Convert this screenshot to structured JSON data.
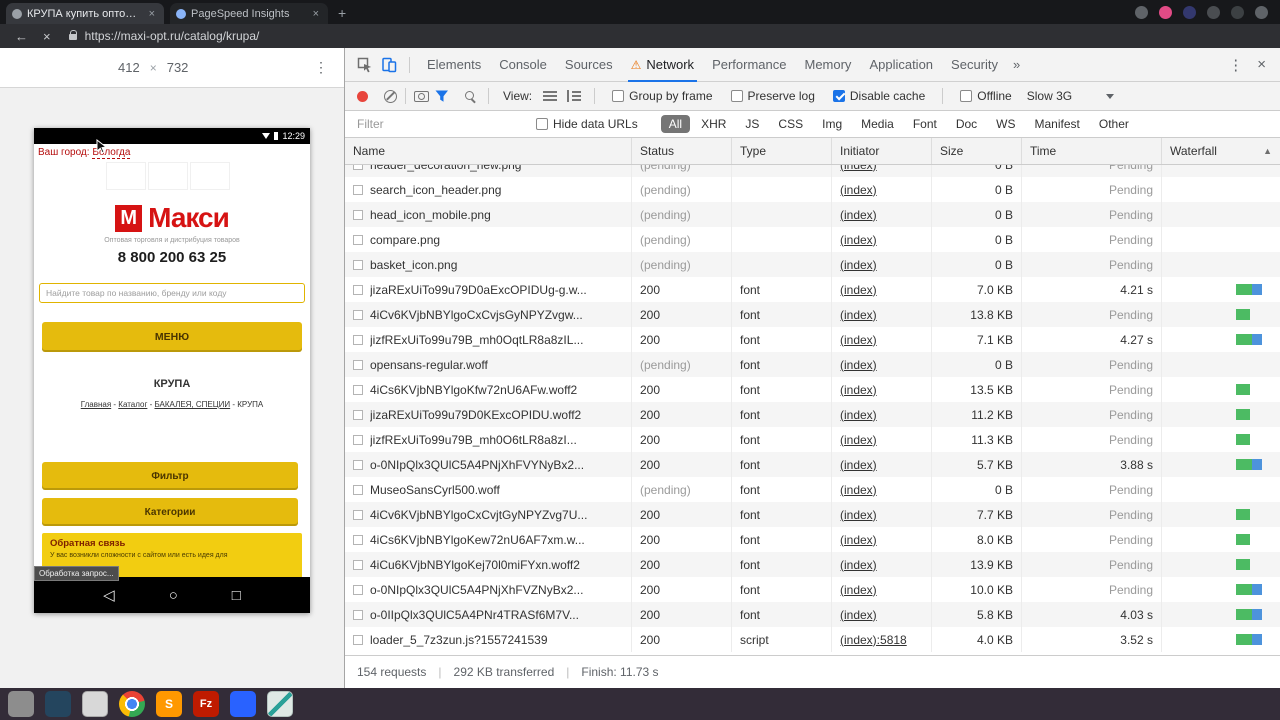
{
  "browser": {
    "tab1": "КРУПА купить оптом | О...",
    "tab2": "PageSpeed Insights",
    "new_tab": "+",
    "url": "https://maxi-opt.ru/catalog/krupa/",
    "icons": {
      "back": "←",
      "stop": "×",
      "close": "×"
    }
  },
  "emulator": {
    "width": "412",
    "height": "732",
    "sep": "×",
    "more": "⋮"
  },
  "mobile": {
    "status_time": "12:29",
    "city_label": "Ваш город:",
    "city_value": "Вологда",
    "logo_m": "М",
    "logo_text": "Макси",
    "tagline": "Оптовая торговля и дистрибуция товаров",
    "phone": "8 800 200 63 25",
    "search_placeholder": "Найдите товар по названию, бренду или коду",
    "menu_button": "МЕНЮ",
    "page_title": "КРУПА",
    "breadcrumbs": [
      "Главная",
      "Каталог",
      "БАКАЛЕЯ, СПЕЦИИ",
      "КРУПА"
    ],
    "breadcrumb_sep": " - ",
    "filter_button": "Фильтр",
    "categories_button": "Категории",
    "feedback_title": "Обратная связь",
    "feedback_text": "У вас возникли сложности с сайтом или есть идея для",
    "tooltip": "Обработка запрос...",
    "nav": {
      "back": "◁",
      "home": "○",
      "recents": "□"
    }
  },
  "devtools": {
    "tabs": [
      "Elements",
      "Console",
      "Sources",
      "Network",
      "Performance",
      "Memory",
      "Application",
      "Security"
    ],
    "active_tab": "Network",
    "tabs_overflow": "»",
    "icons": {
      "more": "⋮",
      "close": "×",
      "sort": "▲",
      "warning": "⚠"
    },
    "toolbar": {
      "view_label": "View:",
      "group_by_frame": "Group by frame",
      "preserve_log": "Preserve log",
      "disable_cache": "Disable cache",
      "offline": "Offline",
      "throttling": "Slow 3G"
    },
    "filter": {
      "placeholder": "Filter",
      "hide_data_urls": "Hide data URLs",
      "pills": [
        "All",
        "XHR",
        "JS",
        "CSS",
        "Img",
        "Media",
        "Font",
        "Doc",
        "WS",
        "Manifest",
        "Other"
      ],
      "active_pill": "All"
    },
    "table": {
      "columns": [
        "Name",
        "Status",
        "Type",
        "Initiator",
        "Size",
        "Time",
        "Waterfall"
      ]
    },
    "rows": [
      {
        "name": "header_decoration_new.png",
        "status": "(pending)",
        "type": "",
        "initiator": "(index)",
        "size": "0 B",
        "time": "Pending",
        "waterfall": "none"
      },
      {
        "name": "search_icon_header.png",
        "status": "(pending)",
        "type": "",
        "initiator": "(index)",
        "size": "0 B",
        "time": "Pending",
        "waterfall": "none"
      },
      {
        "name": "head_icon_mobile.png",
        "status": "(pending)",
        "type": "",
        "initiator": "(index)",
        "size": "0 B",
        "time": "Pending",
        "waterfall": "none"
      },
      {
        "name": "compare.png",
        "status": "(pending)",
        "type": "",
        "initiator": "(index)",
        "size": "0 B",
        "time": "Pending",
        "waterfall": "none"
      },
      {
        "name": "basket_icon.png",
        "status": "(pending)",
        "type": "",
        "initiator": "(index)",
        "size": "0 B",
        "time": "Pending",
        "waterfall": "none"
      },
      {
        "name": "jizaRExUiTo99u79D0aExcOPIDUg-g.w...",
        "status": "200",
        "type": "font",
        "initiator": "(index)",
        "size": "7.0 KB",
        "time": "4.21 s",
        "waterfall": "gb"
      },
      {
        "name": "4iCv6KVjbNBYlgoCxCvjsGyNPYZvgw...",
        "status": "200",
        "type": "font",
        "initiator": "(index)",
        "size": "13.8 KB",
        "time": "Pending",
        "waterfall": "g"
      },
      {
        "name": "jizfRExUiTo99u79B_mh0OqtLR8a8zIL...",
        "status": "200",
        "type": "font",
        "initiator": "(index)",
        "size": "7.1 KB",
        "time": "4.27 s",
        "waterfall": "gb"
      },
      {
        "name": "opensans-regular.woff",
        "status": "(pending)",
        "type": "font",
        "initiator": "(index)",
        "size": "0 B",
        "time": "Pending",
        "waterfall": "none"
      },
      {
        "name": "4iCs6KVjbNBYlgoKfw72nU6AFw.woff2",
        "status": "200",
        "type": "font",
        "initiator": "(index)",
        "size": "13.5 KB",
        "time": "Pending",
        "waterfall": "g"
      },
      {
        "name": "jizaRExUiTo99u79D0KExcOPIDU.woff2",
        "status": "200",
        "type": "font",
        "initiator": "(index)",
        "size": "11.2 KB",
        "time": "Pending",
        "waterfall": "g"
      },
      {
        "name": "jizfRExUiTo99u79B_mh0O6tLR8a8zI...",
        "status": "200",
        "type": "font",
        "initiator": "(index)",
        "size": "11.3 KB",
        "time": "Pending",
        "waterfall": "g"
      },
      {
        "name": "o-0NIpQlx3QUlC5A4PNjXhFVYNyBx2...",
        "status": "200",
        "type": "font",
        "initiator": "(index)",
        "size": "5.7 KB",
        "time": "3.88 s",
        "waterfall": "gb"
      },
      {
        "name": "MuseoSansCyrl500.woff",
        "status": "(pending)",
        "type": "font",
        "initiator": "(index)",
        "size": "0 B",
        "time": "Pending",
        "waterfall": "none"
      },
      {
        "name": "4iCv6KVjbNBYlgoCxCvjtGyNPYZvg7U...",
        "status": "200",
        "type": "font",
        "initiator": "(index)",
        "size": "7.7 KB",
        "time": "Pending",
        "waterfall": "g"
      },
      {
        "name": "4iCs6KVjbNBYlgoKew72nU6AF7xm.w...",
        "status": "200",
        "type": "font",
        "initiator": "(index)",
        "size": "8.0 KB",
        "time": "Pending",
        "waterfall": "g"
      },
      {
        "name": "4iCu6KVjbNBYlgoKej70l0miFYxn.woff2",
        "status": "200",
        "type": "font",
        "initiator": "(index)",
        "size": "13.9 KB",
        "time": "Pending",
        "waterfall": "g"
      },
      {
        "name": "o-0NIpQlx3QUlC5A4PNjXhFVZNyBx2...",
        "status": "200",
        "type": "font",
        "initiator": "(index)",
        "size": "10.0 KB",
        "time": "Pending",
        "waterfall": "gb"
      },
      {
        "name": "o-0IIpQlx3QUlC5A4PNr4TRASf6M7V...",
        "status": "200",
        "type": "font",
        "initiator": "(index)",
        "size": "5.8 KB",
        "time": "4.03 s",
        "waterfall": "gb"
      },
      {
        "name": "loader_5_7z3zun.js?1557241539",
        "status": "200",
        "type": "script",
        "initiator": "(index):5818",
        "size": "4.0 KB",
        "time": "3.52 s",
        "waterfall": "gb"
      }
    ],
    "summary": {
      "requests": "154 requests",
      "sep": "|",
      "transferred": "292 KB transferred",
      "finish": "Finish: 11.73 s"
    }
  },
  "taskbar": {
    "sublime": "S",
    "filezilla": "Fz"
  },
  "colors": {
    "accent_blue": "#1a73e8",
    "brand_yellow": "#e5bb0d",
    "brand_red": "#d61313",
    "waterfall_green": "#4cbb63",
    "waterfall_blue": "#4d93dc",
    "record_red": "#e8453c",
    "warning_orange": "#e8710a"
  }
}
